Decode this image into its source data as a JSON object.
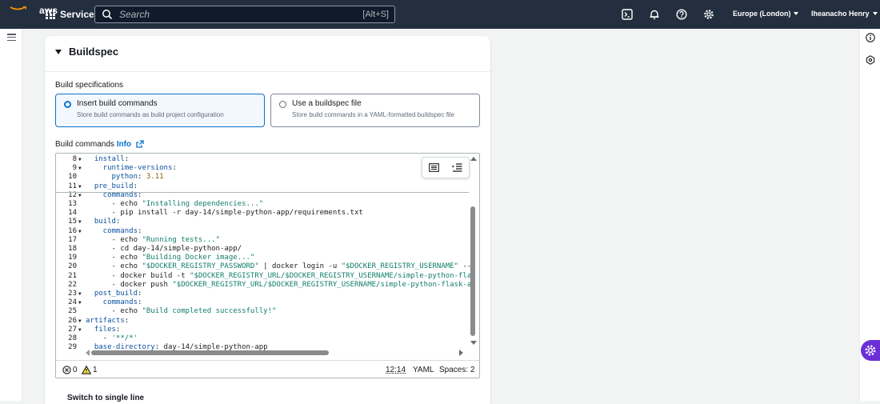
{
  "nav": {
    "logo_text": "aws",
    "services_label": "Services",
    "search_placeholder": "Search",
    "search_shortcut": "[Alt+S]",
    "icons": [
      "cloudshell-icon",
      "notifications-icon",
      "help-icon",
      "settings-icon"
    ],
    "region_label": "Europe (London)",
    "user_label": "Iheanacho Henry"
  },
  "section": {
    "title": "Buildspec",
    "build_specifications_label": "Build specifications",
    "options": [
      {
        "title": "Insert build commands",
        "description": "Store build commands as build project configuration",
        "selected": true
      },
      {
        "title": "Use a buildspec file",
        "description": "Store build commands in a YAML-formatted buildspec file",
        "selected": false
      }
    ],
    "build_commands_label": "Build commands",
    "info_label": "Info",
    "switch_label": "Switch to single line"
  },
  "editor": {
    "lines": [
      {
        "n": "8",
        "fold": true,
        "parts": [
          [
            "k",
            "  install"
          ],
          [
            "p",
            ":"
          ]
        ]
      },
      {
        "n": "9",
        "fold": true,
        "parts": [
          [
            "k",
            "    runtime-versions"
          ],
          [
            "p",
            ":"
          ]
        ]
      },
      {
        "n": "10",
        "fold": false,
        "parts": [
          [
            "k",
            "      python"
          ],
          [
            "p",
            ": "
          ],
          [
            "n",
            "3.11"
          ]
        ]
      },
      {
        "n": "11",
        "fold": true,
        "parts": [
          [
            "k",
            "  pre_build"
          ],
          [
            "p",
            ":"
          ]
        ]
      },
      {
        "n": "12",
        "fold": true,
        "parts": [
          [
            "k",
            "    commands"
          ],
          [
            "p",
            ":"
          ]
        ]
      },
      {
        "n": "13",
        "fold": false,
        "parts": [
          [
            "p",
            "      - echo "
          ],
          [
            "s",
            "\"Installing dependencies...\""
          ]
        ]
      },
      {
        "n": "14",
        "fold": false,
        "parts": [
          [
            "p",
            "      - pip install -r day-14/simple-python-app/requirements.txt"
          ]
        ]
      },
      {
        "n": "15",
        "fold": true,
        "parts": [
          [
            "k",
            "  build"
          ],
          [
            "p",
            ":"
          ]
        ]
      },
      {
        "n": "16",
        "fold": true,
        "parts": [
          [
            "k",
            "    commands"
          ],
          [
            "p",
            ":"
          ]
        ]
      },
      {
        "n": "17",
        "fold": false,
        "parts": [
          [
            "p",
            "      - echo "
          ],
          [
            "s",
            "\"Running tests...\""
          ]
        ]
      },
      {
        "n": "18",
        "fold": false,
        "parts": [
          [
            "p",
            "      - cd day-14/simple-python-app/"
          ]
        ]
      },
      {
        "n": "19",
        "fold": false,
        "parts": [
          [
            "p",
            "      - echo "
          ],
          [
            "s",
            "\"Building Docker image...\""
          ]
        ]
      },
      {
        "n": "20",
        "fold": false,
        "parts": [
          [
            "p",
            "      - echo "
          ],
          [
            "s",
            "\"$DOCKER_REGISTRY_PASSWORD\""
          ],
          [
            "p",
            " | docker login -u "
          ],
          [
            "s",
            "\"$DOCKER_REGISTRY_USERNAME\""
          ],
          [
            "p",
            " --p"
          ]
        ]
      },
      {
        "n": "21",
        "fold": false,
        "parts": [
          [
            "p",
            "      - docker build -t "
          ],
          [
            "s",
            "\"$DOCKER_REGISTRY_URL/$DOCKER_REGISTRY_USERNAME/simple-python-flas"
          ]
        ]
      },
      {
        "n": "22",
        "fold": false,
        "parts": [
          [
            "p",
            "      - docker push "
          ],
          [
            "s",
            "\"$DOCKER_REGISTRY_URL/$DOCKER_REGISTRY_USERNAME/simple-python-flask-ap"
          ]
        ]
      },
      {
        "n": "23",
        "fold": true,
        "parts": [
          [
            "k",
            "  post_build"
          ],
          [
            "p",
            ":"
          ]
        ]
      },
      {
        "n": "24",
        "fold": true,
        "parts": [
          [
            "k",
            "    commands"
          ],
          [
            "p",
            ":"
          ]
        ]
      },
      {
        "n": "25",
        "fold": false,
        "parts": [
          [
            "p",
            "      - echo "
          ],
          [
            "s",
            "\"Build completed successfully!\""
          ]
        ]
      },
      {
        "n": "26",
        "fold": true,
        "parts": [
          [
            "k",
            "artifacts"
          ],
          [
            "p",
            ":"
          ]
        ]
      },
      {
        "n": "27",
        "fold": true,
        "parts": [
          [
            "k",
            "  files"
          ],
          [
            "p",
            ":"
          ]
        ]
      },
      {
        "n": "28",
        "fold": false,
        "parts": [
          [
            "p",
            "    - "
          ],
          [
            "s",
            "'**/*'"
          ]
        ]
      },
      {
        "n": "29",
        "fold": false,
        "parts": [
          [
            "k",
            "  base-directory"
          ],
          [
            "p",
            ": day-14/simple-python-app"
          ]
        ]
      }
    ],
    "errors_count": "0",
    "warnings_count": "1",
    "cursor_position": "12:14",
    "language": "YAML",
    "indent": "Spaces: 2"
  }
}
